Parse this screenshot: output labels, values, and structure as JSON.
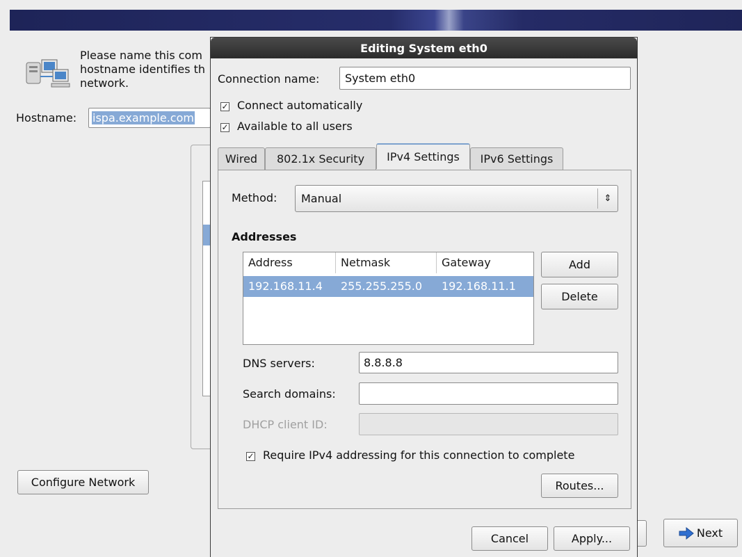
{
  "background": {
    "intro_lines": [
      "Please name this com",
      "hostname identifies th",
      "network."
    ],
    "hostname_label": "Hostname:",
    "hostname_value": "ispa.example.com",
    "configure_network_label": "Configure Network",
    "next_label": "Next"
  },
  "dialog": {
    "title": "Editing System eth0",
    "connection_name_label": "Connection name:",
    "connection_name_value": "System eth0",
    "connect_automatically_label": "Connect automatically",
    "connect_automatically_checked": true,
    "available_all_users_label": "Available to all users",
    "available_all_users_checked": true,
    "tabs": [
      "Wired",
      "802.1x Security",
      "IPv4 Settings",
      "IPv6 Settings"
    ],
    "active_tab": "IPv4 Settings",
    "ipv4": {
      "method_label": "Method:",
      "method_value": "Manual",
      "addresses_heading": "Addresses",
      "columns": [
        "Address",
        "Netmask",
        "Gateway"
      ],
      "rows": [
        {
          "address": "192.168.11.4",
          "netmask": "255.255.255.0",
          "gateway": "192.168.11.1"
        }
      ],
      "add_label": "Add",
      "delete_label": "Delete",
      "dns_label": "DNS servers:",
      "dns_value": "8.8.8.8",
      "search_domains_label": "Search domains:",
      "search_domains_value": "",
      "dhcp_client_id_label": "DHCP client ID:",
      "dhcp_client_id_value": "",
      "require_ipv4_label": "Require IPv4 addressing for this connection to complete",
      "require_ipv4_checked": true,
      "routes_label": "Routes..."
    },
    "cancel_label": "Cancel",
    "apply_label": "Apply..."
  },
  "colors": {
    "selection": "#86a9d6",
    "banner": "#232a62",
    "titlebar": "#333333",
    "next_arrow": "#2f6fd0"
  }
}
